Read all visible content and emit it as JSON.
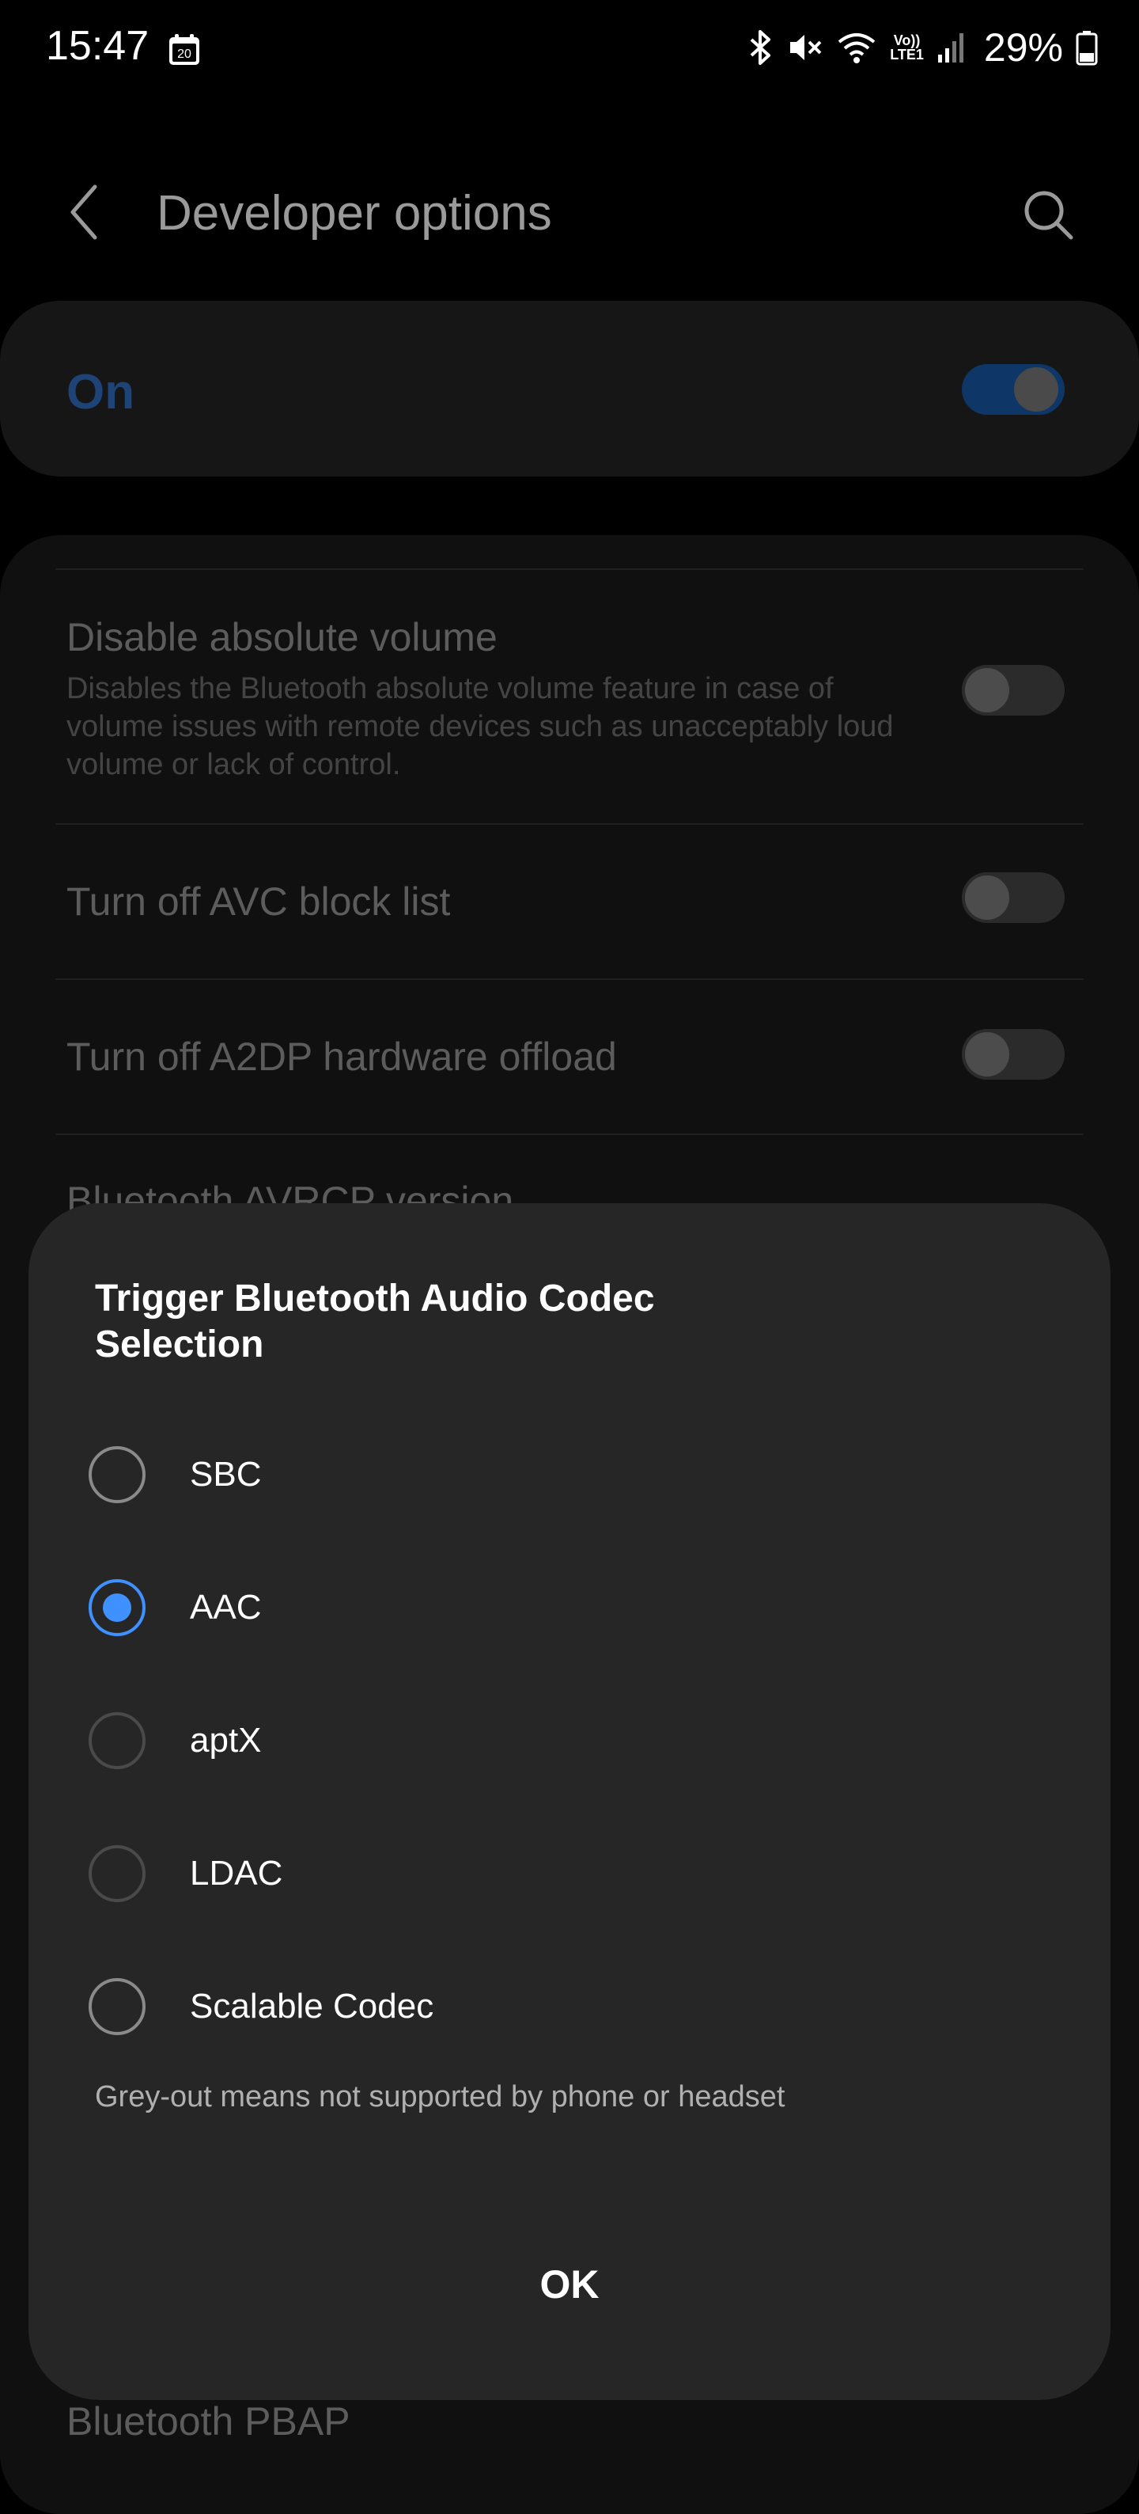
{
  "status_bar": {
    "time": "15:47",
    "calendar_day": "20",
    "volte_line1": "Vo))",
    "volte_line2": "LTE1",
    "battery": "29%",
    "icons": [
      "bluetooth-icon",
      "mute-icon",
      "wifi-icon",
      "volte-icon",
      "signal-icon",
      "battery-icon"
    ]
  },
  "header": {
    "title": "Developer options",
    "back_icon": "chevron-left-icon",
    "search_icon": "search-icon"
  },
  "master_switch": {
    "label": "On",
    "checked": true,
    "accent_color": "#0e3768"
  },
  "settings": [
    {
      "title": "Disable absolute volume",
      "description": "Disables the Bluetooth absolute volume feature in case of volume issues with remote devices such as unacceptably loud volume or lack of control.",
      "checked": false
    },
    {
      "title": "Turn off AVC block list",
      "checked": false
    },
    {
      "title": "Turn off A2DP hardware offload",
      "checked": false
    },
    {
      "title": "Bluetooth AVRCP version"
    }
  ],
  "dialog": {
    "title": "Trigger Bluetooth Audio Codec Selection",
    "options": [
      {
        "label": "SBC",
        "selected": false
      },
      {
        "label": "AAC",
        "selected": true
      },
      {
        "label": "aptX",
        "selected": false
      },
      {
        "label": "LDAC",
        "selected": false
      },
      {
        "label": "Scalable Codec",
        "selected": false
      }
    ],
    "note": "Grey-out means not supported by phone or headset",
    "ok_label": "OK",
    "accent_color": "#3e91ff"
  },
  "bottom_peek": {
    "title": "Bluetooth PBAP"
  }
}
